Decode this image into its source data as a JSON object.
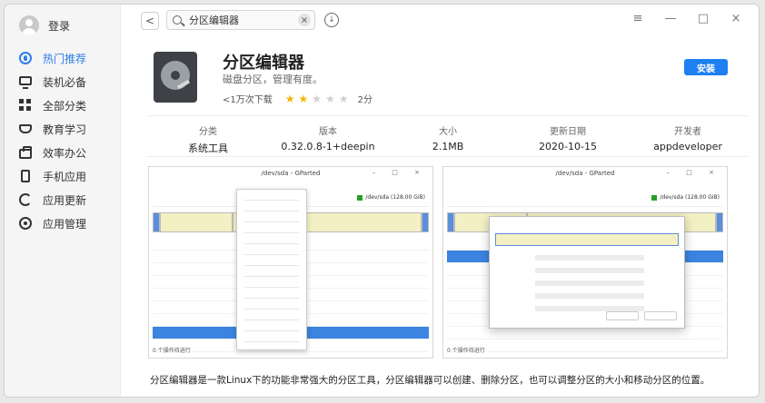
{
  "sidebar": {
    "login_label": "登录",
    "items": [
      {
        "label": "热门推荐",
        "icon": "hot-icon",
        "active": true
      },
      {
        "label": "装机必备",
        "icon": "monitor-icon",
        "active": false
      },
      {
        "label": "全部分类",
        "icon": "grid-icon",
        "active": false
      },
      {
        "label": "教育学习",
        "icon": "education-icon",
        "active": false
      },
      {
        "label": "效率办公",
        "icon": "briefcase-icon",
        "active": false
      },
      {
        "label": "手机应用",
        "icon": "phone-icon",
        "active": false
      },
      {
        "label": "应用更新",
        "icon": "refresh-icon",
        "active": false
      },
      {
        "label": "应用管理",
        "icon": "gear-icon",
        "active": false
      }
    ]
  },
  "topbar": {
    "back_label": "<",
    "search_value": "分区编辑器",
    "clear_label": "×",
    "download_label": "↓",
    "window_controls": [
      "≡",
      "—",
      "□",
      "×"
    ]
  },
  "app": {
    "title": "分区编辑器",
    "subtitle": "磁盘分区，管理有度。",
    "downloads": "<1万次下载",
    "rating": 2,
    "rating_max": 5,
    "rating_label": "2分",
    "install_label": "安装"
  },
  "info": [
    {
      "label": "分类",
      "value": "系统工具"
    },
    {
      "label": "版本",
      "value": "0.32.0.8-1+deepin"
    },
    {
      "label": "大小",
      "value": "2.1MB"
    },
    {
      "label": "更新日期",
      "value": "2020-10-15"
    },
    {
      "label": "开发者",
      "value": "appdeveloper"
    }
  ],
  "screenshots": [
    {
      "title": "/dev/sda - GParted",
      "device": "/dev/sda (128.00 GiB)",
      "status": "0 个操作待进行"
    },
    {
      "title": "/dev/sda - GParted",
      "device": "/dev/sda (128.00 GiB)",
      "status": "0 个操作待进行"
    }
  ],
  "description": "分区编辑器是一款Linux下的功能非常强大的分区工具，分区编辑器可以创建、删除分区，也可以调整分区的大小和移动分区的位置。",
  "colors": {
    "accent": "#1e7ff0",
    "star": "#f7b500",
    "selection": "#3b84e0"
  }
}
